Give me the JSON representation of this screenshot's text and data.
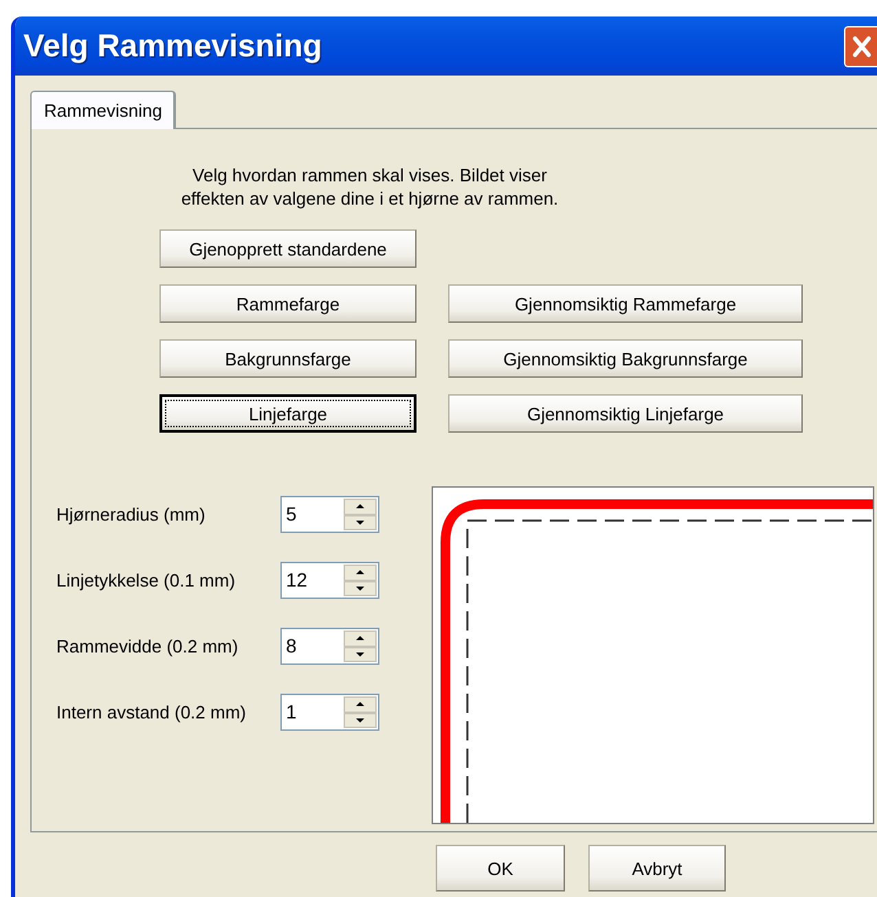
{
  "window": {
    "title": "Velg Rammevisning"
  },
  "tabs": [
    {
      "label": "Rammevisning",
      "selected": true
    }
  ],
  "description": "Velg hvordan rammen skal vises. Bildet viser\neffekten av valgene dine i et hjørne av rammen.",
  "button_rows": [
    [
      {
        "label": "Gjenopprett standardene",
        "focused": false
      }
    ],
    [
      {
        "label": "Rammefarge",
        "focused": false
      },
      {
        "label": "Gjennomsiktig Rammefarge",
        "focused": false
      }
    ],
    [
      {
        "label": "Bakgrunnsfarge",
        "focused": false
      },
      {
        "label": "Gjennomsiktig Bakgrunnsfarge",
        "focused": false
      }
    ],
    [
      {
        "label": "Linjefarge",
        "focused": true
      },
      {
        "label": "Gjennomsiktig Linjefarge",
        "focused": false
      }
    ]
  ],
  "settings": [
    {
      "label": "Hjørneradius (mm)",
      "value": "5"
    },
    {
      "label": "Linjetykkelse (0.1 mm)",
      "value": "12"
    },
    {
      "label": "Rammevidde (0.2 mm)",
      "value": "8"
    },
    {
      "label": "Intern avstand (0.2 mm)",
      "value": "1"
    }
  ],
  "dialog_buttons": [
    "OK",
    "Avbryt"
  ]
}
